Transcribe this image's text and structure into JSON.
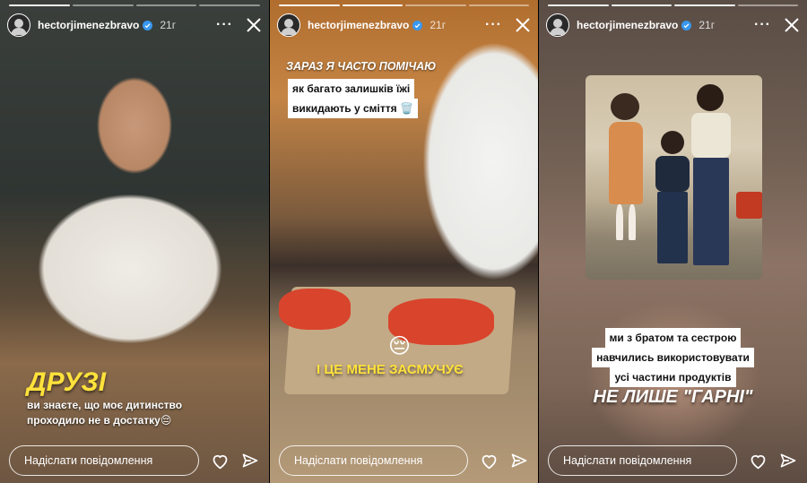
{
  "stories": [
    {
      "username": "hectorjimenezbravo",
      "time": "21г",
      "progress": {
        "segments": 4,
        "completed": 1
      },
      "overlays": {
        "title": "ДРУЗІ",
        "lines": [
          "ви знаєте, що моє дитинство",
          "проходило не в достатку😔"
        ]
      },
      "footer": {
        "placeholder": "Надіслати повідомлення"
      }
    },
    {
      "username": "hectorjimenezbravo",
      "time": "21г",
      "progress": {
        "segments": 4,
        "completed": 2
      },
      "overlays": {
        "heading": "ЗАРАЗ Я ЧАСТО ПОМІЧАЮ",
        "box_lines": [
          "як багато залишків їжі",
          "викидають у сміття 🗑️"
        ],
        "emoji": "😔",
        "bottom": "І ЦЕ МЕНЕ ЗАСМУЧУЄ"
      },
      "footer": {
        "placeholder": "Надіслати повідомлення"
      }
    },
    {
      "username": "hectorjimenezbravo",
      "time": "21г",
      "progress": {
        "segments": 4,
        "completed": 3
      },
      "overlays": {
        "box_lines": [
          "ми з братом та сестрою",
          "навчились використовувати",
          "усі частини продуктів"
        ],
        "bottom": "НЕ ЛИШЕ \"ГАРНІ\""
      },
      "footer": {
        "placeholder": "Надіслати повідомлення"
      }
    }
  ],
  "icons": {
    "more": "more-icon",
    "close": "close-icon",
    "heart": "heart-icon",
    "send": "send-icon",
    "verified": "verified-badge-icon"
  },
  "colors": {
    "accent_yellow": "#ffe23b",
    "verified_blue": "#3897f0"
  }
}
